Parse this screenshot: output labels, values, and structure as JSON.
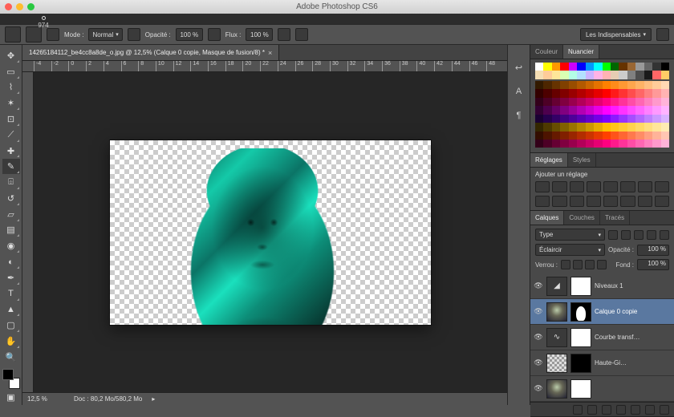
{
  "mac": {
    "title": "Adobe Photoshop CS6"
  },
  "options": {
    "brush_size": "974",
    "mode_label": "Mode :",
    "mode_value": "Normal",
    "opacity_label": "Opacité :",
    "opacity_value": "100 %",
    "flow_label": "Flux :",
    "flow_value": "100 %",
    "workspace_button": "Les Indispensables"
  },
  "document": {
    "tab_title": "14265184112_be4cc8a8de_o.jpg @ 12,5% (Calque 0 copie, Masque de fusion/8) *",
    "ruler_marks": [
      "-4",
      "-2",
      "0",
      "2",
      "4",
      "6",
      "8",
      "10",
      "12",
      "14",
      "16",
      "18",
      "20",
      "22",
      "24",
      "26",
      "28",
      "30",
      "32",
      "34",
      "36",
      "38",
      "40",
      "42",
      "44",
      "46",
      "48"
    ]
  },
  "status": {
    "zoom": "12,5 %",
    "doc_info": "Doc : 80,2 Mo/580,2 Mo"
  },
  "panels": {
    "color": {
      "tab_color": "Couleur",
      "tab_swatches": "Nuancier"
    },
    "adjust": {
      "tab_adjust": "Réglages",
      "tab_styles": "Styles",
      "subtitle": "Ajouter un réglage"
    },
    "layers": {
      "tab_layers": "Calques",
      "tab_channels": "Couches",
      "tab_paths": "Tracés",
      "kind_label": "Type",
      "blend_mode": "Éclaircir",
      "opacity_label": "Opacité :",
      "opacity_value": "100 %",
      "lock_label": "Verrou :",
      "fill_label": "Fond :",
      "fill_value": "100 %",
      "items": [
        {
          "name": "Niveaux 1"
        },
        {
          "name": "Calque 0 copie"
        },
        {
          "name": "Courbe transf…"
        },
        {
          "name": "Haute-Gi…"
        }
      ]
    }
  },
  "swatches_row1": [
    "#ffffff",
    "#ffff00",
    "#ff9900",
    "#ff0000",
    "#cc00ff",
    "#0000ff",
    "#0099ff",
    "#00ffff",
    "#00ff00",
    "#006600",
    "#663300",
    "#996633",
    "#999999",
    "#666666",
    "#333333",
    "#000000",
    "#f5deb3",
    "#ffcc99",
    "#ffe699",
    "#d9ffb3",
    "#b3ffe6",
    "#b3e0ff",
    "#ccb3ff",
    "#ffb3e6",
    "#ffb3b3",
    "#e6ccb3",
    "#cccccc",
    "#808080",
    "#4d4d4d",
    "#1a1a1a",
    "#ff6666",
    "#ffcc66"
  ],
  "swatches_row2": [
    "#331a00",
    "#4d2600",
    "#663300",
    "#804000",
    "#994d00",
    "#b35900",
    "#cc6600",
    "#e67300",
    "#ff8000",
    "#ff8c1a",
    "#ff9933",
    "#ffa64d",
    "#ffb366",
    "#ffbf80",
    "#ffcc99",
    "#ffd9b3",
    "#330000",
    "#4d0000",
    "#660000",
    "#800000",
    "#990000",
    "#b30000",
    "#cc0000",
    "#e60000",
    "#ff0000",
    "#ff1a1a",
    "#ff3333",
    "#ff4d4d",
    "#ff6666",
    "#ff8080",
    "#ff9999",
    "#ffb3b3",
    "#33001a",
    "#4d0026",
    "#660033",
    "#800040",
    "#99004d",
    "#b30059",
    "#cc0066",
    "#e60073",
    "#ff0080",
    "#ff1a8c",
    "#ff3399",
    "#ff4da6",
    "#ff66b3",
    "#ff80bf",
    "#ff99cc",
    "#ffb3d9",
    "#330033",
    "#4d004d",
    "#660066",
    "#800080",
    "#990099",
    "#b300b3",
    "#cc00cc",
    "#e600e6",
    "#ff00ff",
    "#ff1aff",
    "#ff33ff",
    "#ff4dff",
    "#ff66ff",
    "#ff80ff",
    "#ff99ff",
    "#ffb3ff",
    "#1a0033",
    "#26004d",
    "#330066",
    "#400080",
    "#4d0099",
    "#5900b3",
    "#6600cc",
    "#7300e6",
    "#8000ff",
    "#8c1aff",
    "#9933ff",
    "#a64dff",
    "#b366ff",
    "#bf80ff",
    "#cc99ff",
    "#d9b3ff",
    "#332600",
    "#4d3900",
    "#664d00",
    "#806000",
    "#997300",
    "#b38600",
    "#cc9900",
    "#e6ac00",
    "#ffbf00",
    "#ffc61a",
    "#ffcc33",
    "#ffd24d",
    "#ffd966",
    "#ffdf80",
    "#ffe699",
    "#ffecb3",
    "#330d00",
    "#4d1400",
    "#661a00",
    "#802000",
    "#992600",
    "#b32d00",
    "#cc3300",
    "#e63900",
    "#ff4000",
    "#ff531a",
    "#ff6633",
    "#ff794d",
    "#ff8c66",
    "#ff9f80",
    "#ffb399",
    "#ffc6b3",
    "#330019",
    "#4d0026",
    "#660033",
    "#800040",
    "#99004d",
    "#b30059",
    "#cc0066",
    "#e60073",
    "#ff0080",
    "#ff1a8c",
    "#ff3399",
    "#ff4da6",
    "#ff66b3",
    "#ff80bf",
    "#ff99cc",
    "#ffb3d9"
  ]
}
